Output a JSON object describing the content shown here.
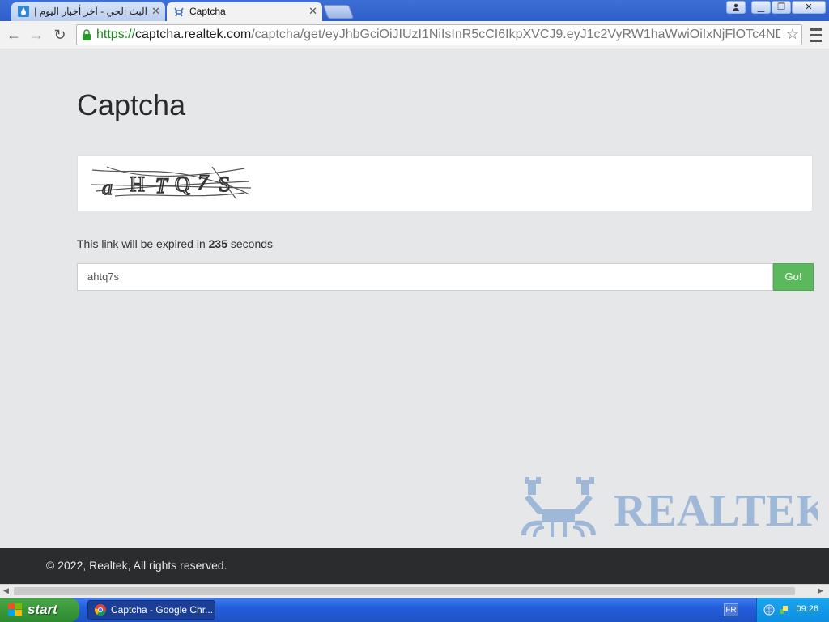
{
  "browser": {
    "tabs": [
      {
        "title": "البث الحي - آخر أخبار اليوم | ال",
        "active": false
      },
      {
        "title": "Captcha",
        "active": true
      }
    ],
    "url": {
      "scheme": "https://",
      "host": "captcha.realtek.com",
      "path": "/captcha/get/eyJhbGciOiJIUzI1NiIsInR5cCI6IkpXVCJ9.eyJ1c2VyRW1haWwiOiIxNjFlOTc4ND"
    }
  },
  "page": {
    "title": "Captcha",
    "expire": {
      "prefix": "This link will be expired in",
      "seconds": "235",
      "suffix": "seconds"
    },
    "code_value": "ahtq7s",
    "go_label": "Go!",
    "logo_text": "REALTEK"
  },
  "footer": {
    "text": "© 2022, Realtek, All rights reserved."
  },
  "taskbar": {
    "start_label": "start",
    "task_label": "Captcha - Google Chr...",
    "lang": "FR",
    "clock": "09:26"
  },
  "colors": {
    "go": "#5cb85c",
    "footer": "#2b2c2e",
    "taskbar": "#245edb"
  }
}
